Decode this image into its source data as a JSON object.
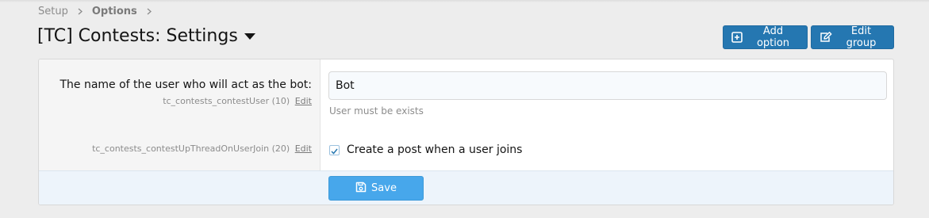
{
  "breadcrumb": {
    "items": [
      {
        "label": "Setup"
      },
      {
        "label": "Options"
      }
    ]
  },
  "page": {
    "title": "[TC] Contests: Settings"
  },
  "actions": {
    "add_option": {
      "label": "Add option",
      "icon": "plus-square-icon"
    },
    "edit_group": {
      "label": "Edit group",
      "icon": "edit-icon"
    }
  },
  "options": [
    {
      "label": "The name of the user who will act as the bot:",
      "option_id": "tc_contests_contestUser (10)",
      "edit_label": "Edit",
      "value": "Bot",
      "explain": "User must be exists"
    },
    {
      "option_id": "tc_contests_contestUpThreadOnUserJoin (20)",
      "edit_label": "Edit",
      "checkbox_label": "Create a post when a user joins",
      "checked": true
    }
  ],
  "footer": {
    "save_label": "Save",
    "save_icon": "save-icon"
  },
  "colors": {
    "primary_button": "#2577b1",
    "save_button": "#47a7eb",
    "footer_bg": "#edf4fb"
  }
}
